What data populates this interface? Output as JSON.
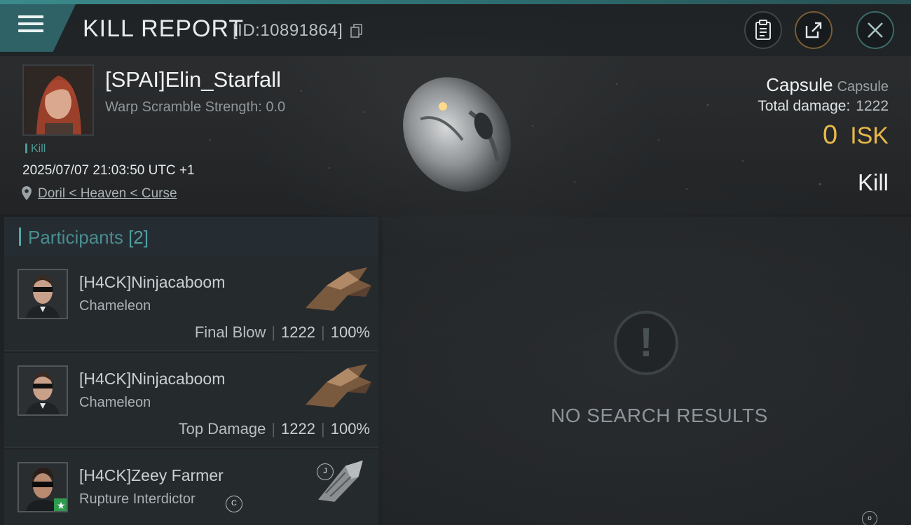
{
  "header": {
    "title": "KILL REPORT",
    "id_text": "[ID:10891864]",
    "icons": [
      "menu-icon",
      "copy-icon",
      "clipboard-icon",
      "share-icon",
      "close-icon"
    ]
  },
  "victim": {
    "name": "[SPAI]Elin_Starfall",
    "warp_scramble": "Warp Scramble Strength: 0.0",
    "kill_tag": "Kill",
    "datetime": "2025/07/07 21:03:50 UTC +1",
    "location": "Doril < Heaven < Curse",
    "ship_name": "Capsule",
    "ship_class": "Capsule",
    "total_damage_label": "Total damage:",
    "total_damage": "1222",
    "isk_value": "0",
    "isk_unit": "ISK",
    "result": "Kill"
  },
  "participants": {
    "title": "Participants",
    "count": "[2]",
    "rows": [
      {
        "name": "[H4CK]Ninjacaboom",
        "ship": "Chameleon",
        "label": "Final Blow",
        "damage": "1222",
        "percent": "100%"
      },
      {
        "name": "[H4CK]Ninjacaboom",
        "ship": "Chameleon",
        "label": "Top Damage",
        "damage": "1222",
        "percent": "100%"
      },
      {
        "name": "[H4CK]Zeey Farmer",
        "ship": "Rupture Interdictor",
        "badge_c": "C",
        "badge_j": "J"
      }
    ]
  },
  "empty_state": {
    "text": "NO SEARCH RESULTS"
  },
  "colors": {
    "accent_teal": "#4e9a97",
    "isk_gold": "#e8b84a"
  }
}
